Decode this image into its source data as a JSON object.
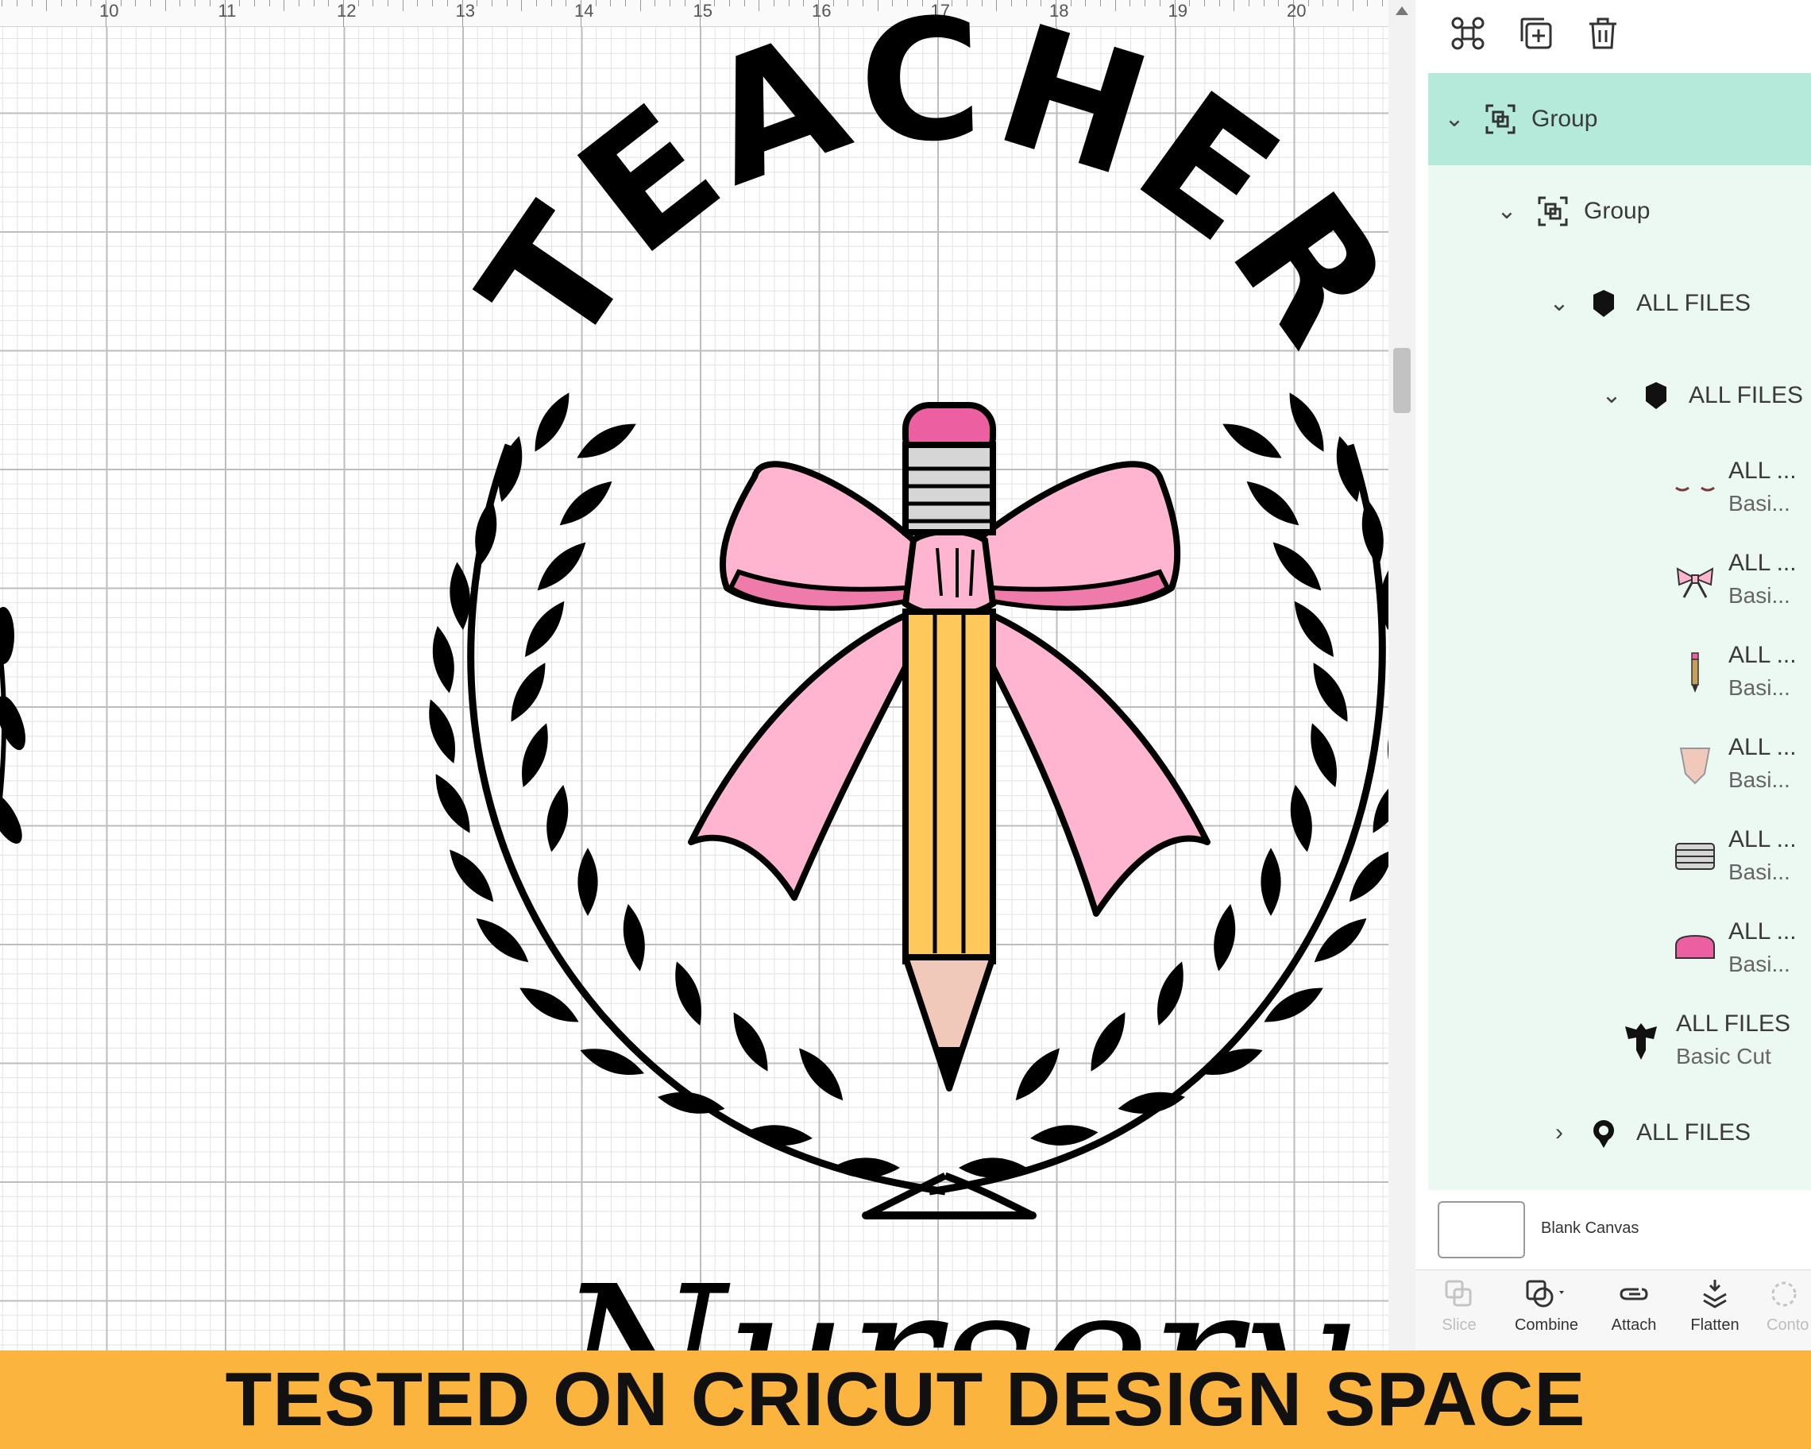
{
  "ruler": {
    "labels": [
      "10",
      "11",
      "12",
      "13",
      "14",
      "15",
      "16",
      "17",
      "18",
      "19",
      "20"
    ]
  },
  "canvas": {
    "arch_text": "TEACHER",
    "script_text": "Nursery"
  },
  "panel": {
    "toolbar": {
      "icons": [
        "ungroup-icon",
        "duplicate-icon",
        "delete-icon"
      ]
    },
    "layers": [
      {
        "label": "Group",
        "level": 0,
        "expanded": true,
        "selected": true,
        "icon": "group-icon"
      },
      {
        "label": "Group",
        "level": 1,
        "expanded": true,
        "icon": "group-icon"
      },
      {
        "label": "ALL FILES",
        "level": 2,
        "expanded": true,
        "icon": "shape-icon"
      },
      {
        "label": "ALL FILES",
        "level": 3,
        "expanded": true,
        "icon": "shape-icon"
      },
      {
        "label": "ALL ...",
        "sub": "Basi...",
        "thumb": "eyelash-thumb"
      },
      {
        "label": "ALL ...",
        "sub": "Basi...",
        "thumb": "bow-thumb"
      },
      {
        "label": "ALL ...",
        "sub": "Basi...",
        "thumb": "pencil-thumb"
      },
      {
        "label": "ALL ...",
        "sub": "Basi...",
        "thumb": "wood-tip-thumb"
      },
      {
        "label": "ALL ...",
        "sub": "Basi...",
        "thumb": "ferrule-thumb"
      },
      {
        "label": "ALL ...",
        "sub": "Basi...",
        "thumb": "eraser-thumb"
      },
      {
        "label": "ALL FILES",
        "sub": "Basic Cut",
        "thumb": "outline-thumb"
      },
      {
        "label": "ALL FILES",
        "level": 2,
        "expanded": false,
        "icon": "shape-icon"
      }
    ],
    "canvas_item": {
      "label": "Blank Canvas"
    },
    "bottom_tools": [
      {
        "label": "Slice",
        "enabled": false
      },
      {
        "label": "Combine",
        "enabled": true
      },
      {
        "label": "Attach",
        "enabled": true
      },
      {
        "label": "Flatten",
        "enabled": true
      },
      {
        "label": "Conto",
        "enabled": false
      }
    ]
  },
  "banner": {
    "text": "TESTED ON CRICUT DESIGN SPACE",
    "color": "#fbb43e"
  },
  "colors": {
    "selected_row": "#b5eadb",
    "tree_bg": "#ecf8f2",
    "pink": "#ffb5d0",
    "pencil_yellow": "#fec95a",
    "eraser_pink": "#ec5fa0"
  }
}
